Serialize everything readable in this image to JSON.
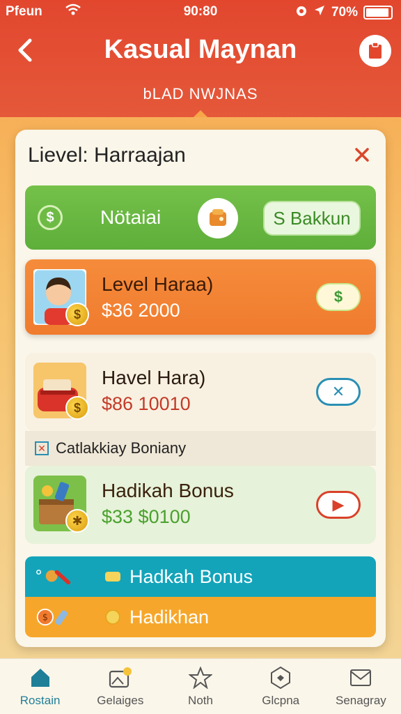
{
  "status_bar": {
    "carrier": "Pfeun",
    "time": "90:80",
    "battery": "70%"
  },
  "header": {
    "title": "Kasual Maynan",
    "subtitle": "bLAD NWJNAS"
  },
  "modal": {
    "title": "Lievel: Harraajan",
    "top_bar": {
      "label": "Nötaiai",
      "button_label": "S Bakkun"
    },
    "items": [
      {
        "name": "Level Haraa)",
        "amount": "$36 2000",
        "action": "$"
      },
      {
        "name": "Havel Hara)",
        "amount": "$86 10010",
        "action": "✕"
      },
      {
        "name": "Hadikah Bonus",
        "amount": "$33 $0100",
        "action": "▶"
      }
    ],
    "category_label": "Catlakkiay Boniany",
    "banner": {
      "row1_label": "Hadkah Bonus",
      "row2_label": "Hadikhan"
    }
  },
  "nav": {
    "items": [
      {
        "label": "Rostain",
        "icon": "home-icon"
      },
      {
        "label": "Gelaiges",
        "icon": "gallery-icon"
      },
      {
        "label": "Noth",
        "icon": "star-icon"
      },
      {
        "label": "Glcpna",
        "icon": "badge-icon"
      },
      {
        "label": "Senagray",
        "icon": "mail-icon"
      }
    ],
    "active_index": 0
  },
  "colors": {
    "header": "#e2472e",
    "accent_teal": "#1f7f98",
    "green": "#5eae3a",
    "orange": "#f07b2e"
  }
}
